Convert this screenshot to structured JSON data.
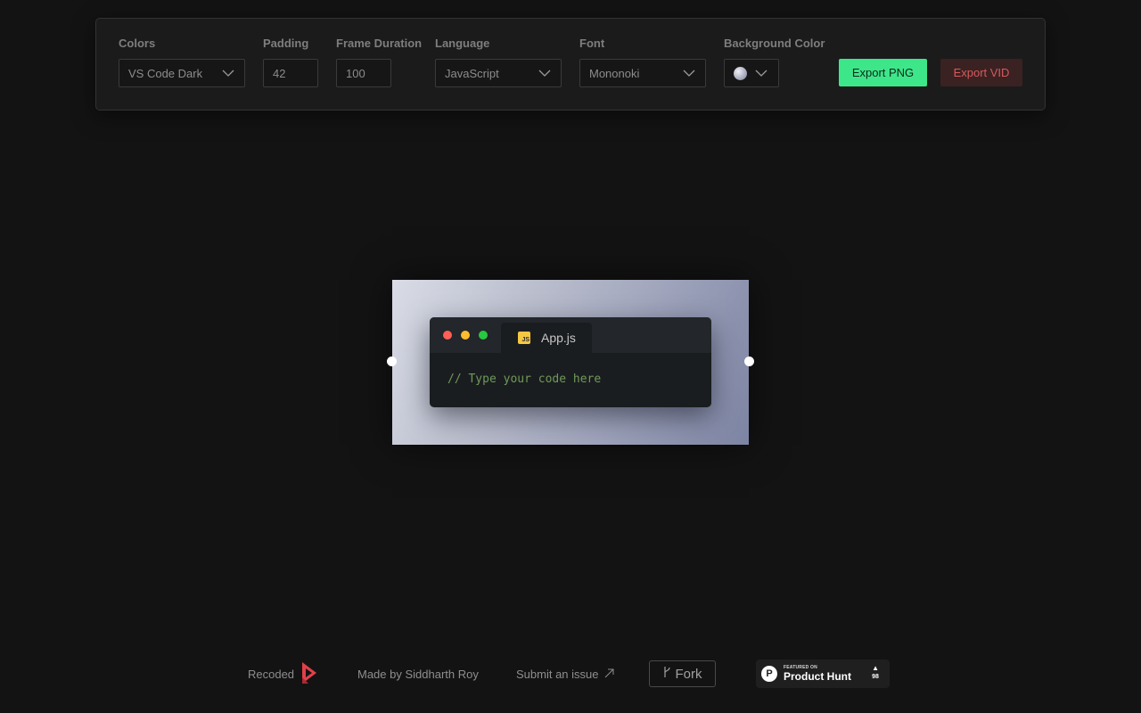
{
  "toolbar": {
    "colors": {
      "label": "Colors",
      "value": "VS Code Dark"
    },
    "padding": {
      "label": "Padding",
      "value": "42"
    },
    "frame_duration": {
      "label": "Frame Duration",
      "value": "100"
    },
    "language": {
      "label": "Language",
      "value": "JavaScript"
    },
    "font": {
      "label": "Font",
      "value": "Mononoki"
    },
    "background_color": {
      "label": "Background Color",
      "swatch": "#b9bccb"
    },
    "export_png": "Export PNG",
    "export_vid": "Export VID"
  },
  "editor": {
    "tab_icon_text": "JS",
    "tab_name": "App.js",
    "code": "// Type your code here",
    "traffic_lights": [
      "#ff5f57",
      "#febc2e",
      "#28c840"
    ]
  },
  "footer": {
    "recoded": "Recoded",
    "made_by": "Made by Siddharth Roy",
    "submit_issue": "Submit an issue",
    "fork": "Fork",
    "product_hunt": {
      "small": "FEATURED ON",
      "big": "Product Hunt",
      "logo_letter": "P",
      "votes": "98"
    }
  },
  "colors": {
    "accent_green": "#3ee68a",
    "accent_red": "#d8595c",
    "background": "#131313"
  }
}
